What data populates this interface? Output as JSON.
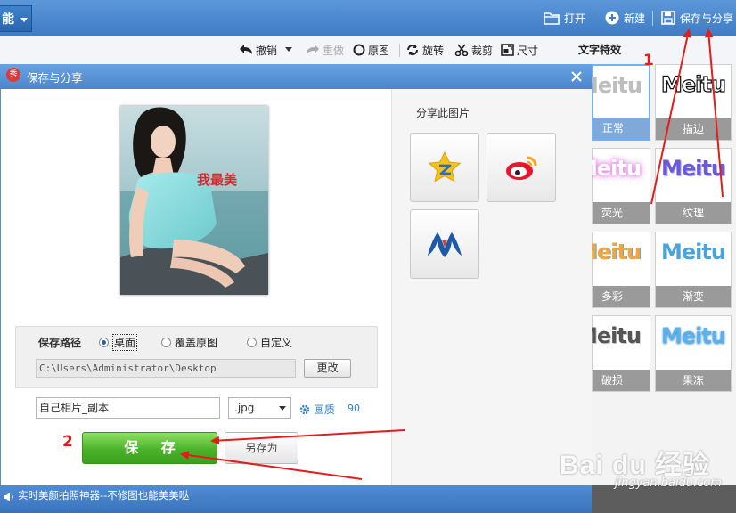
{
  "topbar": {
    "features_tab": "能",
    "open_label": "打开",
    "new_label": "新建",
    "save_share_label": "保存与分享"
  },
  "toolbar": {
    "undo": "撤销",
    "redo": "重做",
    "original": "原图",
    "rotate": "旋转",
    "crop": "裁剪",
    "size": "尺寸",
    "text_effects": "文字特效"
  },
  "effects": [
    {
      "word": "Meitu",
      "label": "正常"
    },
    {
      "word": "Meitu",
      "label": "描边"
    },
    {
      "word": "Meitu",
      "label": "荧光"
    },
    {
      "word": "Meitu",
      "label": "纹理"
    },
    {
      "word": "Meitu",
      "label": "多彩"
    },
    {
      "word": "Meitu",
      "label": "渐变"
    },
    {
      "word": "Meitu",
      "label": "破损"
    },
    {
      "word": "Meitu",
      "label": "果冻"
    }
  ],
  "dialog": {
    "logo_text": "秀",
    "title": "保存与分享",
    "photo_caption": "我最美",
    "share_title": "分享此图片",
    "share_targets": [
      "qzone-icon",
      "weibo-icon",
      "renren-icon"
    ],
    "save_path_label": "保存路径",
    "path_options": [
      {
        "label": "桌面",
        "selected": true
      },
      {
        "label": "覆盖原图",
        "selected": false
      },
      {
        "label": "自定义",
        "selected": false
      }
    ],
    "path_value": "C:\\Users\\Administrator\\Desktop",
    "change_button": "更改",
    "filename": "自己相片_副本",
    "format": ".jpg",
    "quality_label": "画质",
    "quality_value": "90",
    "save_button": "保 存",
    "save_as_button": "另存为"
  },
  "status": {
    "text": "实时美颜拍照神器--不修图也能美美哒"
  },
  "annotations": {
    "step1": "1",
    "step2": "2",
    "arrow_color": "#e11d1d"
  },
  "watermark": {
    "brand": "Bai du 经验",
    "url": "jingyan.baidu.com"
  }
}
